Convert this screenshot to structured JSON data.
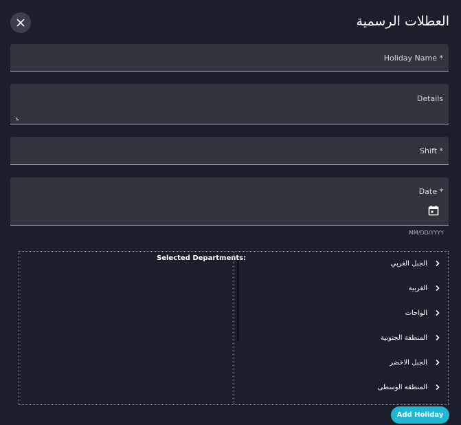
{
  "dialog": {
    "title": "العطلات الرسمية",
    "close_icon": "close-icon"
  },
  "form": {
    "holiday_name_label": "Holiday Name *",
    "details_label": "Details",
    "shift_label": "Shift *",
    "date_label": "Date *",
    "date_hint": "MM/DD/YYYY",
    "calendar_icon": "calendar-icon"
  },
  "departments": {
    "selected_title": "Selected Departments:",
    "items": [
      {
        "label": "الجبل الغربي"
      },
      {
        "label": "الغربية"
      },
      {
        "label": "الواحات"
      },
      {
        "label": "المنطقة الجنوبية"
      },
      {
        "label": "الجبل الاخضر"
      },
      {
        "label": "المنطقة الوسطى"
      }
    ]
  },
  "actions": {
    "add_holiday_label": "Add Holiday"
  },
  "colors": {
    "background": "#1b1f2b",
    "field": "#30343f",
    "accent": "#1fb8d2"
  }
}
